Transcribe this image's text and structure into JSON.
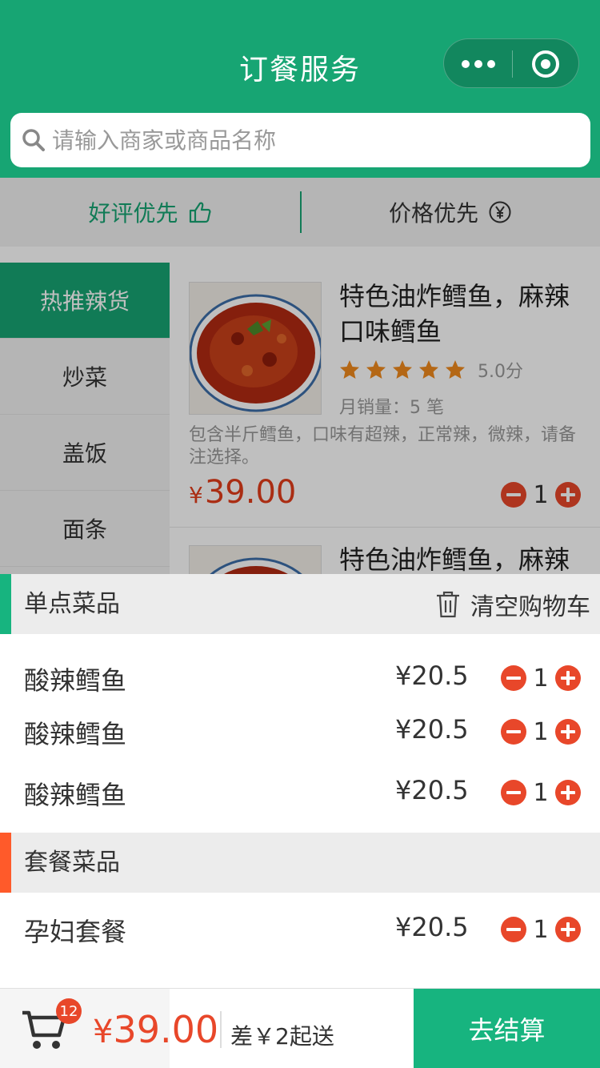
{
  "header": {
    "title": "订餐服务"
  },
  "search": {
    "placeholder": "请输入商家或商品名称"
  },
  "sort": {
    "good_label": "好评优先",
    "price_label": "价格优先"
  },
  "categories": [
    {
      "label": "热推辣货",
      "active": true
    },
    {
      "label": "炒菜",
      "active": false
    },
    {
      "label": "盖饭",
      "active": false
    },
    {
      "label": "面条",
      "active": false
    }
  ],
  "products": [
    {
      "name": "特色油炸鳕鱼，麻辣口味鳕鱼",
      "rating": 5,
      "score": "5.0分",
      "sales": "月销量：5 笔",
      "desc": "包含半斤鳕鱼，口味有超辣，正常辣，微辣，请备注选择。",
      "price_symbol": "¥",
      "price": "39.00",
      "qty": "1"
    },
    {
      "name": "特色油炸鳕鱼，麻辣"
    }
  ],
  "cart": {
    "single_title": "单点菜品",
    "clear_label": "清空购物车",
    "single_items": [
      {
        "name": "酸辣鳕鱼",
        "price": "¥20.5",
        "qty": "1"
      },
      {
        "name": "酸辣鳕鱼",
        "price": "¥20.5",
        "qty": "1"
      },
      {
        "name": "酸辣鳕鱼",
        "price": "¥20.5",
        "qty": "1"
      }
    ],
    "combo_title": "套餐菜品",
    "combo_items": [
      {
        "name": "孕妇套餐",
        "price": "¥20.5",
        "qty": "1"
      }
    ]
  },
  "bottom": {
    "badge": "12",
    "total_symbol": "¥",
    "total": "39.00",
    "gap_text": "差￥2起送",
    "checkout_label": "去结算"
  },
  "colors": {
    "brand": "#17a573",
    "accent": "#e8472a",
    "star": "#f08a1c",
    "combo_bar": "#ff5a2a"
  },
  "icons": [
    "more-dots-icon",
    "target-circle-icon",
    "search-icon",
    "thumbs-up-icon",
    "yen-circle-icon",
    "star-icon",
    "minus-icon",
    "plus-icon",
    "trash-icon",
    "cart-icon"
  ]
}
